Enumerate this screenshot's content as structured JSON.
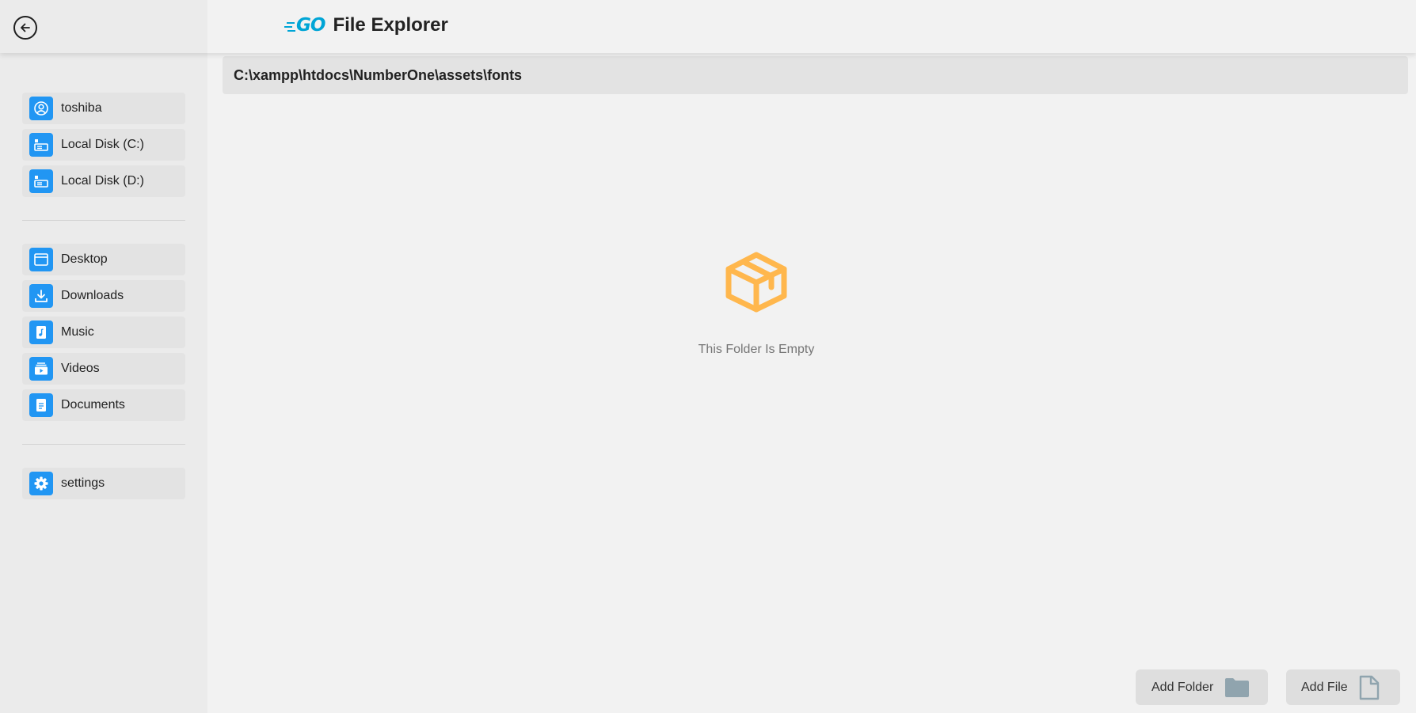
{
  "header": {
    "logo_text": "GO",
    "title": "File Explorer"
  },
  "sidebar": {
    "drives": [
      {
        "label": "toshiba",
        "icon": "user-icon"
      },
      {
        "label": "Local Disk (C:)",
        "icon": "drive-icon"
      },
      {
        "label": "Local Disk (D:)",
        "icon": "drive-icon"
      }
    ],
    "places": [
      {
        "label": "Desktop",
        "icon": "desktop-icon"
      },
      {
        "label": "Downloads",
        "icon": "download-icon"
      },
      {
        "label": "Music",
        "icon": "music-icon"
      },
      {
        "label": "Videos",
        "icon": "video-icon"
      },
      {
        "label": "Documents",
        "icon": "document-icon"
      }
    ],
    "settings": {
      "label": "settings",
      "icon": "gear-icon"
    }
  },
  "path": "C:\\xampp\\htdocs\\NumberOne\\assets\\fonts",
  "empty_state": {
    "message": "This Folder Is Empty",
    "icon": "box-icon"
  },
  "actions": {
    "add_folder": "Add Folder",
    "add_file": "Add File"
  },
  "colors": {
    "accent": "#2196f3",
    "empty_icon": "#ffb74d",
    "logo": "#00a5d6"
  }
}
